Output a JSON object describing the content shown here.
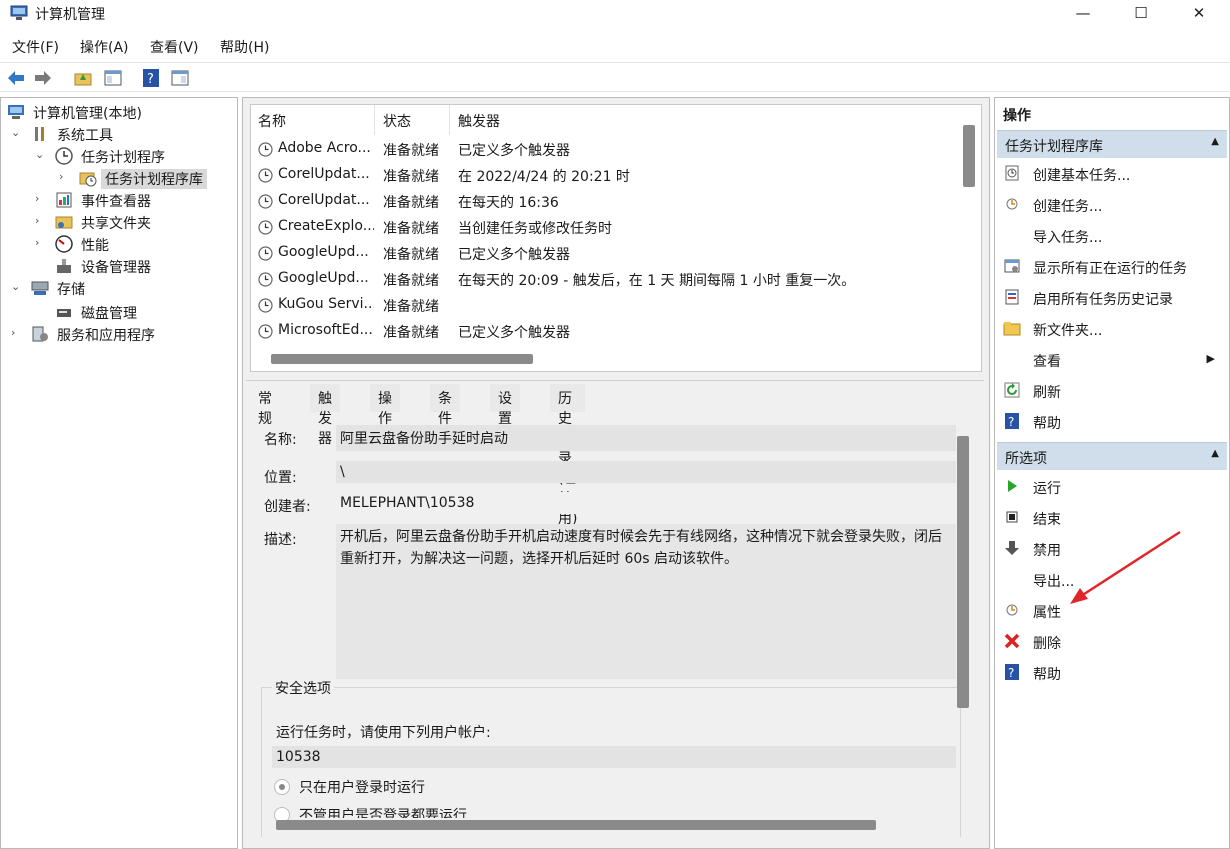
{
  "window": {
    "title": "计算机管理"
  },
  "menu": [
    "文件(F)",
    "操作(A)",
    "查看(V)",
    "帮助(H)"
  ],
  "tree": [
    {
      "label": "计算机管理(本地)",
      "chev": "",
      "name": "tree-item-computer-management"
    },
    {
      "label": "系统工具",
      "chev": "⌄",
      "name": "tree-item-system-tools"
    },
    {
      "label": "任务计划程序",
      "chev": "⌄",
      "name": "tree-item-task-scheduler"
    },
    {
      "label": "任务计划程序库",
      "chev": "›",
      "name": "tree-item-task-library"
    },
    {
      "label": "事件查看器",
      "chev": "›",
      "name": "tree-item-event-viewer"
    },
    {
      "label": "共享文件夹",
      "chev": "›",
      "name": "tree-item-shared-folders"
    },
    {
      "label": "性能",
      "chev": "›",
      "name": "tree-item-performance"
    },
    {
      "label": "设备管理器",
      "chev": "",
      "name": "tree-item-device-manager"
    },
    {
      "label": "存储",
      "chev": "⌄",
      "name": "tree-item-storage"
    },
    {
      "label": "磁盘管理",
      "chev": "",
      "name": "tree-item-disk-management"
    },
    {
      "label": "服务和应用程序",
      "chev": "›",
      "name": "tree-item-services-apps"
    }
  ],
  "task_list": {
    "headers": [
      "名称",
      "状态",
      "触发器"
    ],
    "rows": [
      {
        "name": "Adobe Acro...",
        "status": "准备就绪",
        "trigger": "已定义多个触发器"
      },
      {
        "name": "CorelUpdat...",
        "status": "准备就绪",
        "trigger": "在 2022/4/24 的 20:21 时"
      },
      {
        "name": "CorelUpdat...",
        "status": "准备就绪",
        "trigger": "在每天的 16:36"
      },
      {
        "name": "CreateExplo...",
        "status": "准备就绪",
        "trigger": "当创建任务或修改任务时"
      },
      {
        "name": "GoogleUpd...",
        "status": "准备就绪",
        "trigger": "已定义多个触发器"
      },
      {
        "name": "GoogleUpd...",
        "status": "准备就绪",
        "trigger": "在每天的 20:09 - 触发后，在 1 天 期间每隔 1 小时 重复一次。"
      },
      {
        "name": "KuGou Servi...",
        "status": "准备就绪",
        "trigger": ""
      },
      {
        "name": "MicrosoftEd...",
        "status": "准备就绪",
        "trigger": "已定义多个触发器"
      }
    ]
  },
  "tabs": [
    "常规",
    "触发器",
    "操作",
    "条件",
    "设置",
    "历史记录(已禁用)"
  ],
  "general": {
    "name_label": "名称:",
    "name_value": "阿里云盘备份助手延时启动",
    "location_label": "位置:",
    "location_value": "\\",
    "author_label": "创建者:",
    "author_value": "MELEPHANT\\10538",
    "desc_label": "描述:",
    "desc_value": "开机后，阿里云盘备份助手开机启动速度有时候会先于有线网络，这种情况下就会登录失败，闭后重新打开，为解决这一问题，选择开机后延时 60s 启动该软件。",
    "security_title": "安全选项",
    "run_as_text": "运行任务时，请使用下列用户帐户:",
    "user_value": "10538",
    "radio1": "只在用户登录时运行",
    "radio2": "不管用户是否登录都要运行"
  },
  "actions": {
    "title": "操作",
    "section1": "任务计划程序库",
    "items1": [
      {
        "label": "创建基本任务...",
        "icon": "create-basic-task-icon"
      },
      {
        "label": "创建任务...",
        "icon": "create-task-icon"
      },
      {
        "label": "导入任务...",
        "icon": ""
      },
      {
        "label": "显示所有正在运行的任务",
        "icon": "running-tasks-icon"
      },
      {
        "label": "启用所有任务历史记录",
        "icon": "history-icon"
      },
      {
        "label": "新文件夹...",
        "icon": "folder-icon"
      },
      {
        "label": "查看",
        "icon": ""
      },
      {
        "label": "刷新",
        "icon": "refresh-icon"
      },
      {
        "label": "帮助",
        "icon": "help-icon"
      }
    ],
    "section2": "所选项",
    "items2": [
      {
        "label": "运行",
        "icon": "run-icon"
      },
      {
        "label": "结束",
        "icon": "stop-icon"
      },
      {
        "label": "禁用",
        "icon": "disable-icon"
      },
      {
        "label": "导出...",
        "icon": ""
      },
      {
        "label": "属性",
        "icon": "properties-icon"
      },
      {
        "label": "删除",
        "icon": "delete-icon"
      },
      {
        "label": "帮助",
        "icon": "help-icon"
      }
    ]
  }
}
